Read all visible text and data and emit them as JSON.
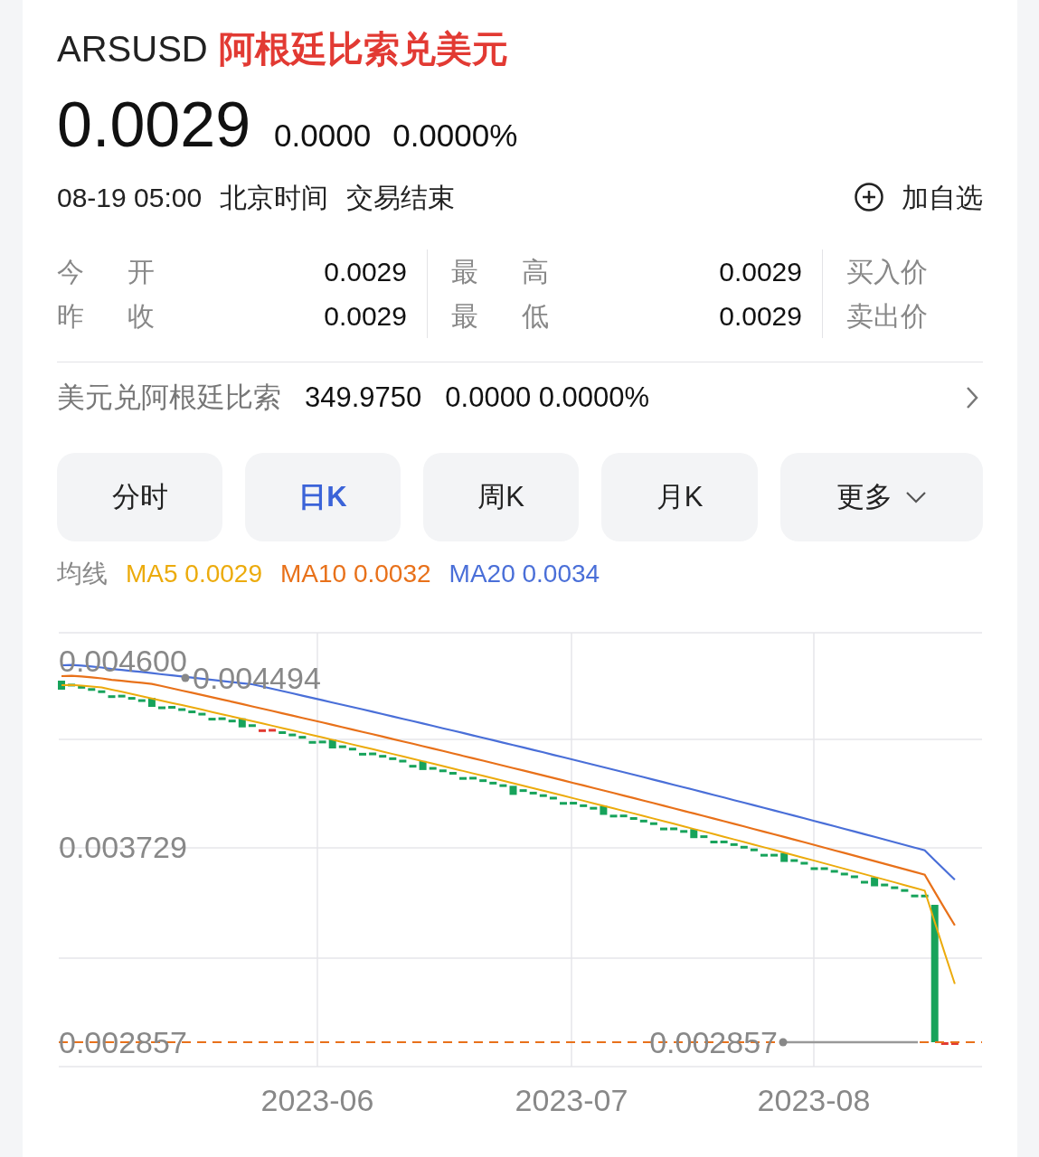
{
  "header": {
    "symbol": "ARSUSD",
    "name": "阿根廷比索兑美元"
  },
  "quote": {
    "price": "0.0029",
    "change": "0.0000",
    "change_percent": "0.0000%"
  },
  "status": {
    "time": "08-19 05:00",
    "timezone": "北京时间",
    "state": "交易结束",
    "watch_button": "加自选"
  },
  "stats": [
    {
      "label": "今 开",
      "value": "0.0029"
    },
    {
      "label": "最 高",
      "value": "0.0029"
    },
    {
      "label": "买入价"
    },
    {
      "label": "昨 收",
      "value": "0.0029"
    },
    {
      "label": "最 低",
      "value": "0.0029"
    },
    {
      "label": "卖出价"
    }
  ],
  "inverse": {
    "label": "美元兑阿根廷比索",
    "price": "349.9750",
    "change": "0.0000 0.0000%"
  },
  "tabs": [
    {
      "label": "分时",
      "selected": false
    },
    {
      "label": "日K",
      "selected": true
    },
    {
      "label": "周K",
      "selected": false
    },
    {
      "label": "月K",
      "selected": false
    },
    {
      "label": "更多",
      "selected": false,
      "kind": "dropdown"
    }
  ],
  "ma_legend": {
    "label": "均线",
    "items": [
      {
        "text": "MA5 0.0029",
        "color": "#ecab0c"
      },
      {
        "text": "MA10 0.0032",
        "color": "#e8711a"
      },
      {
        "text": "MA20 0.0034",
        "color": "#4a6fd8"
      }
    ]
  },
  "chart": {
    "y_labels": [
      "0.004600",
      "0.003729",
      "0.002857"
    ],
    "x_labels": [
      "2023-06",
      "2023-07",
      "2023-08"
    ],
    "max_marker": "0.004494",
    "min_marker": "0.002857"
  }
}
